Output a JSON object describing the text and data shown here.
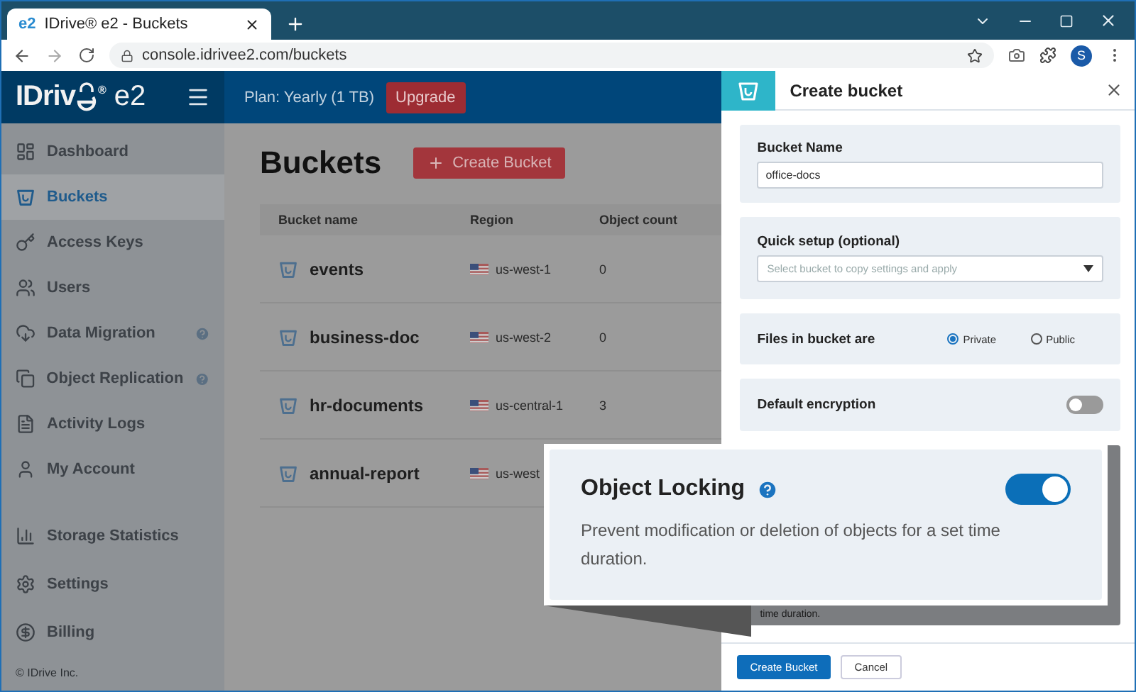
{
  "browser": {
    "tab_title": "IDrive® e2 - Buckets",
    "tab_icon": "e2",
    "url": "console.idrivee2.com/buckets",
    "avatar": "S"
  },
  "header": {
    "logo": "IDriv",
    "logo_mark": "®",
    "logo_suffix": "e2",
    "plan": "Plan: Yearly (1 TB)",
    "upgrade": "Upgrade"
  },
  "sidebar": {
    "items": [
      {
        "label": "Dashboard",
        "selected": false,
        "help": false
      },
      {
        "label": "Buckets",
        "selected": true,
        "help": false
      },
      {
        "label": "Access Keys",
        "selected": false,
        "help": false
      },
      {
        "label": "Users",
        "selected": false,
        "help": false
      },
      {
        "label": "Data Migration",
        "selected": false,
        "help": true
      },
      {
        "label": "Object Replication",
        "selected": false,
        "help": true
      },
      {
        "label": "Activity Logs",
        "selected": false,
        "help": false
      },
      {
        "label": "My Account",
        "selected": false,
        "help": false
      }
    ],
    "bottom_items": [
      {
        "label": "Storage Statistics",
        "selected": false
      },
      {
        "label": "Settings",
        "selected": false
      },
      {
        "label": "Billing",
        "selected": false
      }
    ],
    "footer": "© IDrive Inc."
  },
  "page": {
    "title": "Buckets",
    "create_button": "Create Bucket"
  },
  "table": {
    "columns": [
      "Bucket name",
      "Region",
      "Object count"
    ],
    "rows": [
      {
        "name": "events",
        "region": "us-west-1",
        "count": "0"
      },
      {
        "name": "business-doc",
        "region": "us-west-2",
        "count": "0"
      },
      {
        "name": "hr-documents",
        "region": "us-central-1",
        "count": "3"
      },
      {
        "name": "annual-report",
        "region": "us-west"
      }
    ]
  },
  "panel": {
    "title": "Create bucket",
    "bucket_name": {
      "label": "Bucket Name",
      "value": "office-docs"
    },
    "quick_setup": {
      "label": "Quick setup (optional)",
      "placeholder": "Select bucket to copy settings and apply"
    },
    "files": {
      "label": "Files in bucket are",
      "options": [
        {
          "label": "Private",
          "selected": true
        },
        {
          "label": "Public",
          "selected": false
        }
      ]
    },
    "encryption": {
      "label": "Default encryption",
      "on": false
    },
    "covered_text": "time duration.",
    "buttons": [
      "Create Bucket",
      "Cancel"
    ]
  },
  "callout": {
    "title": "Object Locking",
    "description": "Prevent modification or deletion of objects for a set time duration.",
    "on": true
  }
}
